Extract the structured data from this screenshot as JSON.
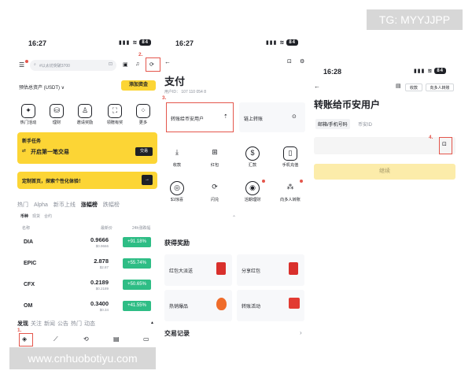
{
  "watermarks": {
    "top": "TG: MYYJJPP",
    "bottom": "www.cnhuobotiyu.com"
  },
  "status": {
    "time1": "16:27",
    "time2": "16:27",
    "time3": "16:28",
    "signal": "▮▮▮ ≋",
    "battery": "84"
  },
  "screen1": {
    "search_placeholder": "#以太坊突破3700",
    "asset_label": "预估总资产 (USDT) ∨",
    "add_funds": "添加资金",
    "shortcuts": [
      "热门活动",
      "理财",
      "邀请奖励",
      "领赠有奖",
      "更多"
    ],
    "task_title": "新手任务",
    "task_text": "开启第一笔交易",
    "task_btn": "交易",
    "custom_banner": "定制首页，探索个性化体验！",
    "market_tabs": [
      "热门",
      "Alpha",
      "新币上线",
      "涨幅榜",
      "跌幅榜"
    ],
    "sub_tabs": [
      "币种",
      "现货",
      "合约"
    ],
    "col_name": "名称",
    "col_price": "最新价",
    "col_change": "24h涨跌幅",
    "rows": [
      {
        "sym": "DIA",
        "price": "0.9666",
        "sub": "$0.9666",
        "chg": "+91.18%"
      },
      {
        "sym": "EPIC",
        "price": "2.878",
        "sub": "$2.87",
        "chg": "+55.74%"
      },
      {
        "sym": "CFX",
        "price": "0.2189",
        "sub": "$0.2189",
        "chg": "+50.65%"
      },
      {
        "sym": "OM",
        "price": "0.3400",
        "sub": "$0.34",
        "chg": "+41.55%"
      }
    ],
    "news_tabs": [
      "发现",
      "关注",
      "新闻",
      "公告",
      "热门",
      "动态"
    ],
    "marker1": "1.",
    "marker2": "2."
  },
  "screen2": {
    "title": "支付",
    "uid": "用户ID： 107 110 054 8",
    "marker3": "3.",
    "send_binance": "转账给币安用户",
    "onchain": "链上转账",
    "grid": [
      "收款",
      "红包",
      "汇款",
      "手机充值",
      "$1惊喜",
      "闪兑",
      "活期理财",
      "向多人转账"
    ],
    "rewards_title": "获得奖励",
    "rewards": [
      "红包大派送",
      "分享红包",
      "热销爆品",
      "转账活动"
    ],
    "records": "交易记录"
  },
  "screen3": {
    "receive": "收款",
    "multi": "向多人转账",
    "title": "转账给币安用户",
    "tab_active": "邮箱/手机号码",
    "tab_other": "币安ID",
    "marker4": "4.",
    "continue": "继续"
  },
  "colors": {
    "accent": "#fcd535",
    "green": "#2ebd85",
    "marker": "#e4564c"
  }
}
